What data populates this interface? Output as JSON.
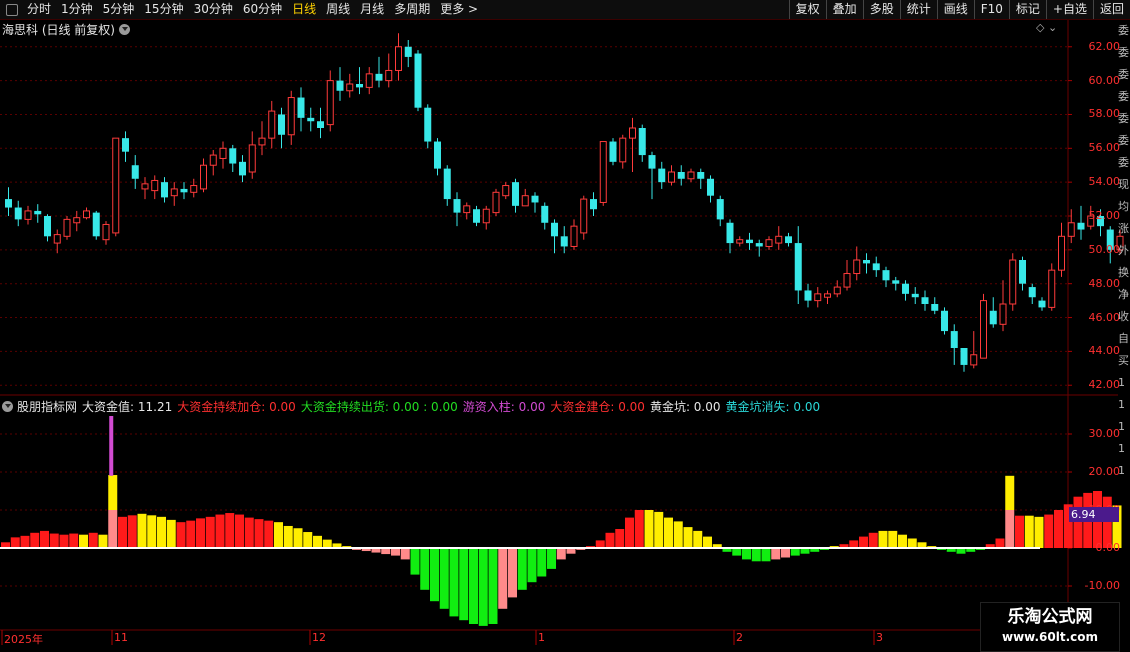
{
  "toolbar": {
    "periods": [
      "分时",
      "1分钟",
      "5分钟",
      "15分钟",
      "30分钟",
      "60分钟",
      "日线",
      "周线",
      "月线",
      "多周期",
      "更多 >"
    ],
    "active_period": "日线",
    "buttons": [
      "复权",
      "叠加",
      "多股",
      "统计",
      "画线",
      "F10",
      "标记",
      "+自选",
      "返回"
    ]
  },
  "main_chart": {
    "title": "海思科 (日线 前复权)",
    "price_ticks": [
      "62.00",
      "60.00",
      "58.00",
      "56.00",
      "54.00",
      "52.00",
      "50.00",
      "48.00",
      "46.00",
      "44.00",
      "42.00"
    ],
    "corner_icons": "◇ ⌄"
  },
  "indicator": {
    "name": "股朋指标网",
    "items": [
      {
        "text": "大资金值: 11.21",
        "color": "#e6e6e6"
      },
      {
        "text": "大资金持续加仓: 0.00",
        "color": "#ff3030"
      },
      {
        "text": "大资金持续出货: 0.00 : 0.00",
        "color": "#22dd22"
      },
      {
        "text": "游资入柱: 0.00",
        "color": "#d24bd2"
      },
      {
        "text": "大资金建仓: 0.00",
        "color": "#ff3030"
      },
      {
        "text": "黄金坑: 0.00",
        "color": "#e6e6e6"
      },
      {
        "text": "黄金坑消失: 0.00",
        "color": "#2ad8d8"
      }
    ],
    "ticks": [
      "30.00",
      "20.00",
      "10.00",
      "0.00",
      "-10.00"
    ],
    "current_value": "6.94"
  },
  "date_axis": [
    "2025年",
    "11",
    "12",
    "1",
    "2",
    "3"
  ],
  "right_strip": [
    "委",
    "委",
    "委",
    "委",
    "委",
    "委",
    "委",
    "现",
    "均",
    "涨",
    "外",
    "换",
    "净",
    "收",
    "",
    "",
    "",
    "",
    "自",
    "买",
    "1",
    "1",
    "1",
    "1",
    "1"
  ],
  "watermark": {
    "line1": "乐淘公式网",
    "line2": "www.60lt.com"
  },
  "chart_data": {
    "type": "candlestick",
    "candles": [
      [
        53.0,
        52.5,
        53.7,
        52.0
      ],
      [
        52.5,
        51.8,
        52.9,
        51.4
      ],
      [
        51.8,
        52.3,
        52.6,
        51.5
      ],
      [
        52.3,
        52.1,
        52.7,
        51.6
      ],
      [
        52.0,
        50.8,
        52.1,
        50.5
      ],
      [
        50.4,
        50.9,
        51.2,
        49.8
      ],
      [
        50.8,
        51.8,
        52.0,
        50.6
      ],
      [
        51.6,
        51.9,
        52.3,
        51.1
      ],
      [
        51.9,
        52.3,
        52.5,
        51.8
      ],
      [
        52.2,
        50.8,
        52.3,
        50.6
      ],
      [
        50.6,
        51.5,
        51.7,
        50.3
      ],
      [
        51.0,
        56.6,
        56.6,
        50.8
      ],
      [
        56.6,
        55.8,
        57.0,
        55.2
      ],
      [
        55.0,
        54.2,
        55.6,
        53.6
      ],
      [
        53.6,
        53.9,
        54.3,
        53.0
      ],
      [
        53.5,
        54.1,
        54.4,
        53.0
      ],
      [
        54.0,
        53.1,
        54.3,
        52.8
      ],
      [
        53.2,
        53.6,
        54.0,
        52.6
      ],
      [
        53.6,
        53.4,
        54.0,
        53.0
      ],
      [
        53.4,
        53.8,
        54.2,
        53.1
      ],
      [
        53.6,
        55.0,
        55.4,
        53.4
      ],
      [
        55.0,
        55.6,
        55.9,
        54.4
      ],
      [
        55.4,
        56.0,
        56.4,
        54.8
      ],
      [
        56.0,
        55.1,
        56.2,
        54.6
      ],
      [
        55.2,
        54.4,
        55.6,
        54.0
      ],
      [
        54.6,
        56.2,
        57.0,
        54.2
      ],
      [
        56.2,
        56.6,
        57.6,
        55.6
      ],
      [
        56.6,
        58.2,
        58.8,
        56.0
      ],
      [
        58.0,
        56.8,
        58.4,
        56.0
      ],
      [
        56.8,
        59.0,
        59.4,
        56.2
      ],
      [
        59.0,
        57.8,
        59.6,
        57.0
      ],
      [
        57.8,
        57.6,
        58.4,
        57.0
      ],
      [
        57.6,
        57.2,
        58.4,
        56.6
      ],
      [
        57.4,
        60.0,
        60.6,
        57.0
      ],
      [
        60.0,
        59.4,
        60.8,
        58.8
      ],
      [
        59.4,
        59.8,
        60.4,
        59.0
      ],
      [
        59.8,
        59.6,
        60.8,
        59.2
      ],
      [
        59.6,
        60.4,
        60.8,
        59.2
      ],
      [
        60.4,
        60.0,
        61.4,
        59.6
      ],
      [
        60.0,
        60.6,
        61.6,
        59.6
      ],
      [
        60.6,
        62.0,
        62.8,
        60.0
      ],
      [
        62.0,
        61.4,
        62.4,
        60.8
      ],
      [
        61.6,
        58.4,
        61.8,
        58.2
      ],
      [
        58.4,
        56.4,
        58.6,
        56.0
      ],
      [
        56.4,
        54.8,
        56.6,
        54.4
      ],
      [
        54.8,
        53.0,
        55.0,
        52.6
      ],
      [
        53.0,
        52.2,
        53.4,
        51.4
      ],
      [
        52.2,
        52.6,
        52.8,
        51.8
      ],
      [
        52.4,
        51.6,
        52.6,
        51.4
      ],
      [
        51.6,
        52.4,
        52.6,
        51.2
      ],
      [
        52.2,
        53.4,
        53.6,
        52.0
      ],
      [
        53.2,
        53.8,
        54.0,
        53.0
      ],
      [
        54.0,
        52.6,
        54.2,
        52.2
      ],
      [
        52.6,
        53.2,
        53.6,
        52.6
      ],
      [
        53.2,
        52.8,
        53.4,
        52.2
      ],
      [
        52.6,
        51.6,
        52.8,
        51.2
      ],
      [
        51.6,
        50.8,
        51.8,
        49.8
      ],
      [
        50.8,
        50.2,
        51.4,
        49.8
      ],
      [
        50.2,
        51.4,
        51.8,
        50.0
      ],
      [
        51.0,
        53.0,
        53.2,
        50.6
      ],
      [
        53.0,
        52.4,
        53.4,
        52.0
      ],
      [
        52.8,
        56.4,
        56.4,
        52.6
      ],
      [
        56.4,
        55.2,
        56.6,
        55.0
      ],
      [
        55.2,
        56.6,
        56.8,
        54.8
      ],
      [
        56.6,
        57.2,
        57.8,
        54.6
      ],
      [
        57.2,
        55.6,
        57.4,
        55.2
      ],
      [
        55.6,
        54.8,
        55.8,
        53.0
      ],
      [
        54.8,
        54.0,
        55.2,
        53.6
      ],
      [
        54.0,
        54.6,
        55.0,
        53.8
      ],
      [
        54.6,
        54.2,
        55.0,
        53.8
      ],
      [
        54.2,
        54.6,
        54.8,
        54.0
      ],
      [
        54.6,
        54.2,
        54.8,
        53.6
      ],
      [
        54.2,
        53.2,
        54.4,
        52.8
      ],
      [
        53.0,
        51.8,
        53.2,
        51.4
      ],
      [
        51.6,
        50.4,
        51.8,
        49.8
      ],
      [
        50.4,
        50.6,
        50.8,
        50.2
      ],
      [
        50.6,
        50.4,
        51.0,
        50.0
      ],
      [
        50.4,
        50.2,
        50.6,
        49.6
      ],
      [
        50.2,
        50.6,
        50.8,
        50.0
      ],
      [
        50.4,
        50.8,
        51.4,
        50.0
      ],
      [
        50.8,
        50.4,
        51.0,
        50.2
      ],
      [
        50.4,
        47.6,
        51.4,
        46.8
      ],
      [
        47.6,
        47.0,
        48.0,
        46.6
      ],
      [
        47.0,
        47.4,
        47.8,
        46.6
      ],
      [
        47.2,
        47.4,
        47.6,
        46.8
      ],
      [
        47.4,
        47.8,
        48.2,
        47.2
      ],
      [
        47.8,
        48.6,
        49.4,
        47.6
      ],
      [
        48.6,
        49.4,
        50.2,
        48.2
      ],
      [
        49.4,
        49.2,
        49.8,
        48.6
      ],
      [
        49.2,
        48.8,
        49.6,
        48.4
      ],
      [
        48.8,
        48.2,
        49.0,
        47.8
      ],
      [
        48.2,
        48.0,
        48.4,
        47.6
      ],
      [
        48.0,
        47.4,
        48.2,
        47.0
      ],
      [
        47.4,
        47.2,
        47.8,
        46.8
      ],
      [
        47.2,
        46.8,
        47.6,
        46.4
      ],
      [
        46.8,
        46.4,
        47.2,
        46.2
      ],
      [
        46.4,
        45.2,
        46.6,
        45.0
      ],
      [
        45.2,
        44.2,
        45.6,
        43.2
      ],
      [
        44.2,
        43.2,
        44.2,
        42.8
      ],
      [
        43.2,
        43.8,
        45.2,
        43.0
      ],
      [
        43.6,
        47.0,
        47.4,
        43.6
      ],
      [
        46.4,
        45.6,
        47.2,
        45.4
      ],
      [
        45.6,
        46.8,
        48.2,
        45.2
      ],
      [
        46.8,
        49.4,
        49.8,
        46.4
      ],
      [
        49.4,
        48.0,
        49.6,
        47.6
      ],
      [
        47.8,
        47.2,
        48.0,
        46.8
      ],
      [
        47.0,
        46.6,
        47.2,
        46.4
      ],
      [
        46.6,
        48.8,
        49.2,
        46.4
      ],
      [
        48.8,
        50.8,
        51.6,
        48.4
      ],
      [
        50.8,
        51.6,
        52.4,
        50.4
      ],
      [
        51.6,
        51.2,
        52.6,
        50.6
      ],
      [
        51.4,
        52.0,
        52.6,
        51.2
      ],
      [
        52.0,
        51.4,
        52.4,
        50.8
      ],
      [
        51.2,
        50.0,
        51.4,
        49.2
      ],
      [
        50.0,
        50.8,
        51.2,
        49.8
      ]
    ],
    "indicator_bars": [
      1.5,
      2.8,
      3.2,
      4.0,
      4.5,
      3.8,
      3.5,
      3.8,
      3.5,
      4.0,
      3.5,
      11.2,
      8.2,
      8.6,
      9.0,
      8.6,
      8.2,
      7.4,
      6.8,
      7.2,
      7.8,
      8.2,
      8.8,
      9.2,
      8.8,
      8.0,
      7.6,
      7.2,
      6.8,
      5.8,
      5.2,
      4.2,
      3.2,
      2.2,
      1.2,
      0.5,
      -0.5,
      -0.8,
      -1.2,
      -1.6,
      -2.0,
      -3.0,
      -7.0,
      -11.0,
      -14.0,
      -16.0,
      -18.0,
      -19.0,
      -20.0,
      -20.5,
      -20.0,
      -16.0,
      -13.0,
      -11.0,
      -9.0,
      -7.5,
      -5.5,
      -3.0,
      -1.5,
      -0.5,
      0.5,
      2.0,
      4.0,
      5.0,
      8.0,
      10.0,
      10.0,
      9.5,
      8.0,
      7.0,
      5.5,
      4.5,
      3.0,
      1.0,
      -1.0,
      -2.0,
      -3.0,
      -3.5,
      -3.5,
      -3.0,
      -2.5,
      -2.0,
      -1.5,
      -1.0,
      -0.5,
      0.5,
      1.0,
      2.0,
      3.0,
      4.0,
      4.5,
      4.5,
      3.5,
      2.5,
      1.5,
      0.5,
      -0.5,
      -1.0,
      -1.5,
      -1.0,
      -0.5,
      1.0,
      2.5,
      11.0,
      8.5,
      8.5,
      8.2,
      8.8,
      10.0,
      11.5,
      13.5,
      14.5,
      15.0,
      13.5,
      11.2
    ],
    "indicator_colors": [
      "r",
      "r",
      "r",
      "r",
      "r",
      "r",
      "r",
      "r",
      "y",
      "r",
      "y",
      "pk",
      "r",
      "r",
      "y",
      "y",
      "y",
      "y",
      "r",
      "r",
      "r",
      "r",
      "r",
      "r",
      "r",
      "r",
      "r",
      "r",
      "y",
      "y",
      "y",
      "y",
      "y",
      "y",
      "y",
      "y",
      "p",
      "p",
      "p",
      "p",
      "p",
      "p",
      "g",
      "g",
      "g",
      "g",
      "g",
      "g",
      "g",
      "g",
      "g",
      "p",
      "p",
      "g",
      "g",
      "g",
      "g",
      "p",
      "p",
      "p",
      "r",
      "r",
      "r",
      "r",
      "r",
      "r",
      "y",
      "y",
      "y",
      "y",
      "y",
      "y",
      "y",
      "y",
      "g",
      "g",
      "g",
      "g",
      "g",
      "p",
      "p",
      "g",
      "g",
      "g",
      "g",
      "y",
      "r",
      "r",
      "r",
      "r",
      "y",
      "y",
      "y",
      "y",
      "y",
      "y",
      "g",
      "g",
      "g",
      "g",
      "g",
      "r",
      "r",
      "yk",
      "r",
      "y",
      "y",
      "r",
      "r",
      "r",
      "r",
      "r",
      "r",
      "r",
      "y"
    ],
    "spike_index": 11
  }
}
